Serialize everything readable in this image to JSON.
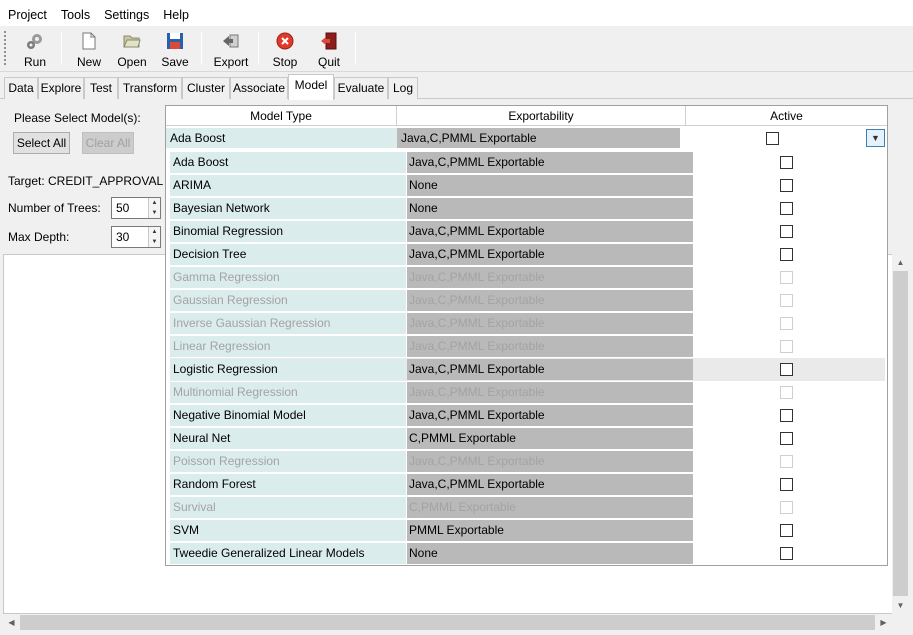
{
  "menu": [
    {
      "label": "Project"
    },
    {
      "label": "Tools"
    },
    {
      "label": "Settings"
    },
    {
      "label": "Help"
    }
  ],
  "toolbar": {
    "run": "Run",
    "new": "New",
    "open": "Open",
    "save": "Save",
    "export": "Export",
    "stop": "Stop",
    "quit": "Quit"
  },
  "tabs": [
    "Data",
    "Explore",
    "Test",
    "Transform",
    "Cluster",
    "Associate",
    "Model",
    "Evaluate",
    "Log"
  ],
  "active_tab": "Model",
  "left": {
    "select_label": "Please Select Model(s):",
    "select_all": "Select All",
    "clear_all": "Clear All",
    "target": "Target: CREDIT_APPROVAL",
    "trees_label": "Number of Trees:",
    "trees_value": "50",
    "depth_label": "Max Depth:",
    "depth_value": "30"
  },
  "table": {
    "headers": {
      "model_type": "Model Type",
      "exportability": "Exportability",
      "active": "Active"
    },
    "selected": {
      "name": "Ada Boost",
      "exportability": "Java,C,PMML Exportable",
      "checked": false
    },
    "rows": [
      {
        "name": "Ada Boost",
        "exportability": "Java,C,PMML Exportable",
        "enabled": true,
        "checked": false
      },
      {
        "name": "ARIMA",
        "exportability": "None",
        "enabled": true,
        "checked": false
      },
      {
        "name": "Bayesian Network",
        "exportability": "None",
        "enabled": true,
        "checked": false
      },
      {
        "name": "Binomial Regression",
        "exportability": "Java,C,PMML Exportable",
        "enabled": true,
        "checked": false
      },
      {
        "name": "Decision Tree",
        "exportability": "Java,C,PMML Exportable",
        "enabled": true,
        "checked": false
      },
      {
        "name": "Gamma Regression",
        "exportability": "Java,C,PMML Exportable",
        "enabled": false,
        "checked": false
      },
      {
        "name": "Gaussian Regression",
        "exportability": "Java,C,PMML Exportable",
        "enabled": false,
        "checked": false
      },
      {
        "name": "Inverse Gaussian Regression",
        "exportability": "Java,C,PMML Exportable",
        "enabled": false,
        "checked": false
      },
      {
        "name": "Linear Regression",
        "exportability": "Java,C,PMML Exportable",
        "enabled": false,
        "checked": false
      },
      {
        "name": "Logistic Regression",
        "exportability": "Java,C,PMML Exportable",
        "enabled": true,
        "checked": false,
        "hover": true
      },
      {
        "name": "Multinomial Regression",
        "exportability": "Java,C,PMML Exportable",
        "enabled": false,
        "checked": false
      },
      {
        "name": "Negative Binomial Model",
        "exportability": "Java,C,PMML Exportable",
        "enabled": true,
        "checked": false
      },
      {
        "name": "Neural Net",
        "exportability": "C,PMML Exportable",
        "enabled": true,
        "checked": false
      },
      {
        "name": "Poisson Regression",
        "exportability": "Java,C,PMML Exportable",
        "enabled": false,
        "checked": false
      },
      {
        "name": "Random Forest",
        "exportability": "Java,C,PMML Exportable",
        "enabled": true,
        "checked": false
      },
      {
        "name": "Survival",
        "exportability": "C,PMML Exportable",
        "enabled": false,
        "checked": false
      },
      {
        "name": "SVM",
        "exportability": "PMML Exportable",
        "enabled": true,
        "checked": false
      },
      {
        "name": "Tweedie Generalized Linear Models",
        "exportability": "None",
        "enabled": true,
        "checked": false
      }
    ]
  }
}
